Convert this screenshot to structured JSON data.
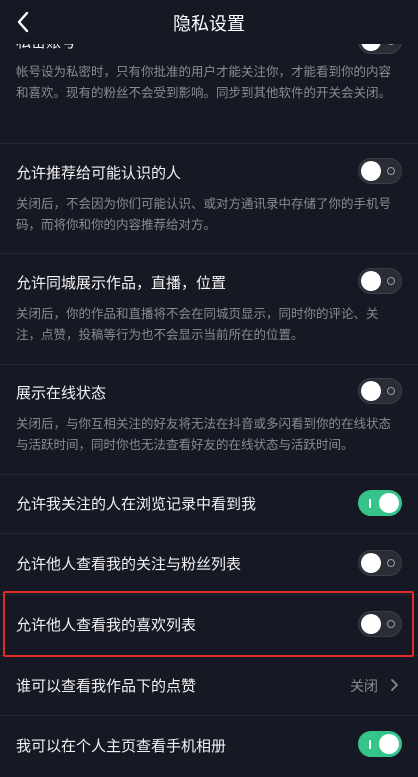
{
  "header": {
    "title": "隐私设置"
  },
  "private_account": {
    "label": "私密账号",
    "desc": "帐号设为私密时，只有你批准的用户才能关注你，才能看到你的内容和喜欢。现有的粉丝不会受到影响。同步到其他软件的开关会关闭。",
    "state": "off"
  },
  "recommend_to_known": {
    "label": "允许推荐给可能认识的人",
    "desc": "关闭后，不会因为你们可能认识、或对方通讯录中存储了你的手机号码，而将你和你的内容推荐给对方。",
    "state": "off"
  },
  "same_city": {
    "label": "允许同城展示作品，直播，位置",
    "desc": "关闭后，你的作品和直播将不会在同城页显示，同时你的评论、关注，点赞，投稿等行为也不会显示当前所在的位置。",
    "state": "off"
  },
  "online_status": {
    "label": "展示在线状态",
    "desc": "关闭后，与你互相关注的好友将无法在抖音或多闪看到你的在线状态与活跃时间，同时你也无法查看好友的在线状态与活跃时间。",
    "state": "off"
  },
  "browse_history": {
    "label": "允许我关注的人在浏览记录中看到我",
    "state": "on"
  },
  "follow_list": {
    "label": "允许他人查看我的关注与粉丝列表",
    "state": "off"
  },
  "like_list": {
    "label": "允许他人查看我的喜欢列表",
    "state": "off"
  },
  "likes_viewer": {
    "label": "谁可以查看我作品下的点赞",
    "value": "关闭"
  },
  "album": {
    "label": "我可以在个人主页查看手机相册",
    "state": "on"
  }
}
